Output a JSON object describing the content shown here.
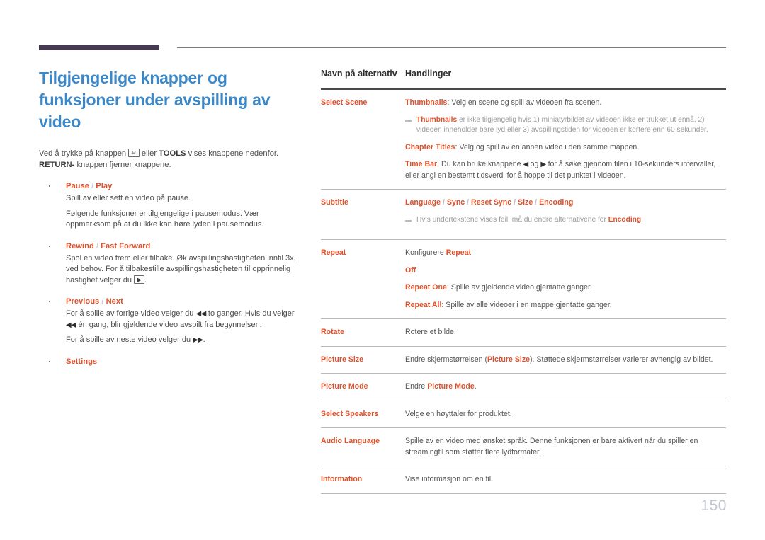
{
  "document": {
    "page_number": "150",
    "accent_blue": "#3b87c8",
    "accent_orange": "#e0502a",
    "rule_dark": "#443a52",
    "rule_thin": "#7b7b80"
  },
  "left": {
    "title": "Tilgjengelige knapper og funksjoner under avspilling av video",
    "intro_1": "Ved å trykke på knappen",
    "intro_key_enter": "↵",
    "intro_2": "eller",
    "intro_bold_tools": "TOOLS",
    "intro_3": "vises knappene nedenfor.",
    "intro_bold_return": "RETURN-",
    "intro_4": "knappen fjerner knappene.",
    "bullets": [
      {
        "head_a": "Pause",
        "head_sep": "/",
        "head_b": "Play",
        "body": [
          "Spill av eller sett en video på pause.",
          "Følgende funksjoner er tilgjengelige i pausemodus. Vær oppmerksom på at du ikke kan høre lyden i pausemodus."
        ]
      },
      {
        "head_a": "Rewind",
        "head_sep": "/",
        "head_b": "Fast Forward",
        "body_pre": "Spol en video frem eller tilbake. Øk avspillingshastigheten inntil 3x, ved behov. For å tilbakestille avspillingshastigheten til opprinnelig hastighet velger du",
        "body_key": "▶",
        "body_post": "."
      },
      {
        "head_a": "Previous",
        "head_sep": "/",
        "head_b": "Next",
        "line1_pre": "For å spille av forrige video velger du",
        "line1_glyph1": "◀◀",
        "line1_mid": "to ganger. Hvis du velger",
        "line1_glyph2": "◀◀",
        "line1_post": "én gang, blir gjeldende video avspilt fra begynnelsen.",
        "line2_pre": "For å spille av neste video velger du",
        "line2_glyph": "▶▶",
        "line2_post": "."
      },
      {
        "head_a": "Settings",
        "head_sep": "",
        "head_b": ""
      }
    ]
  },
  "table": {
    "headers": {
      "col1": "Navn på alternativ",
      "col2": "Handlinger"
    },
    "rows": [
      {
        "name": "Select Scene",
        "lines": [
          {
            "kind": "text",
            "bold": "Thumbnails",
            "rest": ": Velg en scene og spill av videoen fra scenen."
          },
          {
            "kind": "note",
            "bold": "Thumbnails",
            "rest": " er ikke tilgjengelig hvis 1) miniatyrbildet av videoen ikke er trukket ut ennå, 2) videoen inneholder bare lyd eller 3) avspillingstiden for videoen er kortere enn 60 sekunder."
          },
          {
            "kind": "text",
            "bold": "Chapter Titles",
            "rest": ": Velg og spill av en annen video i den samme mappen."
          },
          {
            "kind": "timebar",
            "bold": "Time Bar",
            "rest_a": ": Du kan bruke knappene",
            "glyph_left": "◀",
            "mid": "og",
            "glyph_right": "▶",
            "rest_b": "for å søke gjennom filen i 10-sekunders intervaller, eller angi en bestemt tidsverdi for å hoppe til det punktet i videoen."
          }
        ]
      },
      {
        "name": "Subtitle",
        "lines": [
          {
            "kind": "slashes",
            "parts": [
              "Language",
              "Sync",
              "Reset Sync",
              "Size",
              "Encoding"
            ]
          },
          {
            "kind": "note",
            "pre": "Hvis undertekstene vises feil, må du endre alternativene for ",
            "bold": "Encoding",
            "rest": "."
          }
        ]
      },
      {
        "name": "Repeat",
        "lines": [
          {
            "kind": "textpre",
            "pre": "Konfigurere ",
            "bold": "Repeat",
            "rest": "."
          },
          {
            "kind": "boldonly",
            "bold": "Off"
          },
          {
            "kind": "text",
            "bold": "Repeat One",
            "rest": ": Spille av gjeldende video gjentatte ganger."
          },
          {
            "kind": "text",
            "bold": "Repeat All",
            "rest": ": Spille av alle videoer i en mappe gjentatte ganger."
          }
        ]
      },
      {
        "name": "Rotate",
        "lines": [
          {
            "kind": "plain",
            "rest": "Rotere et bilde."
          }
        ]
      },
      {
        "name": "Picture Size",
        "lines": [
          {
            "kind": "midbold",
            "pre": "Endre skjermstørrelsen (",
            "bold": "Picture Size",
            "rest": "). Støttede skjermstørrelser varierer avhengig av bildet."
          }
        ]
      },
      {
        "name": "Picture Mode",
        "lines": [
          {
            "kind": "textpre",
            "pre": "Endre ",
            "bold": "Picture Mode",
            "rest": "."
          }
        ]
      },
      {
        "name": "Select Speakers",
        "lines": [
          {
            "kind": "plain",
            "rest": "Velge en høyttaler for produktet."
          }
        ]
      },
      {
        "name": "Audio Language",
        "lines": [
          {
            "kind": "plain",
            "rest": "Spille av en video med ønsket språk. Denne funksjonen er bare aktivert når du spiller en streamingfil som støtter flere lydformater."
          }
        ]
      },
      {
        "name": "Information",
        "lines": [
          {
            "kind": "plain",
            "rest": "Vise informasjon om en fil."
          }
        ]
      }
    ]
  }
}
